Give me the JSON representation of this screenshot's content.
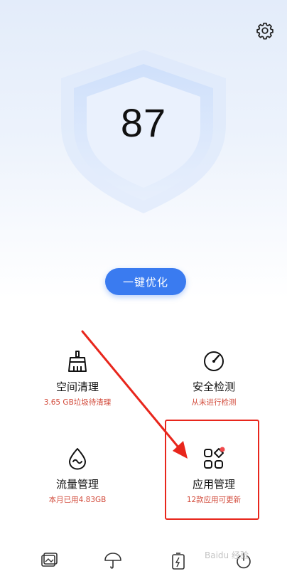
{
  "header": {
    "settings_icon": "gear-icon"
  },
  "score": {
    "value": "87",
    "shield_icon": "shield-icon"
  },
  "optimize_button": {
    "label": "一键优化"
  },
  "tiles": [
    {
      "title": "空间清理",
      "subtitle": "3.65 GB垃圾待清理",
      "icon": "broom-icon"
    },
    {
      "title": "安全检测",
      "subtitle": "从未进行检测",
      "icon": "gauge-icon"
    },
    {
      "title": "流量管理",
      "subtitle": "本月已用4.83GB",
      "icon": "droplet-icon"
    },
    {
      "title": "应用管理",
      "subtitle": "12款应用可更新",
      "icon": "apps-grid-icon"
    }
  ],
  "bottom_bar": {
    "items": [
      {
        "icon": "image-icon",
        "label": ""
      },
      {
        "icon": "umbrella-icon",
        "label": ""
      },
      {
        "icon": "battery-icon",
        "label": ""
      },
      {
        "icon": "power-icon",
        "label": ""
      }
    ]
  },
  "annotations": {
    "highlight_color": "#e8261c"
  },
  "watermark": {
    "text": "Baidu 经验"
  },
  "colors": {
    "accent": "#3a7bf0",
    "subtitle_red": "#d24a3a"
  }
}
